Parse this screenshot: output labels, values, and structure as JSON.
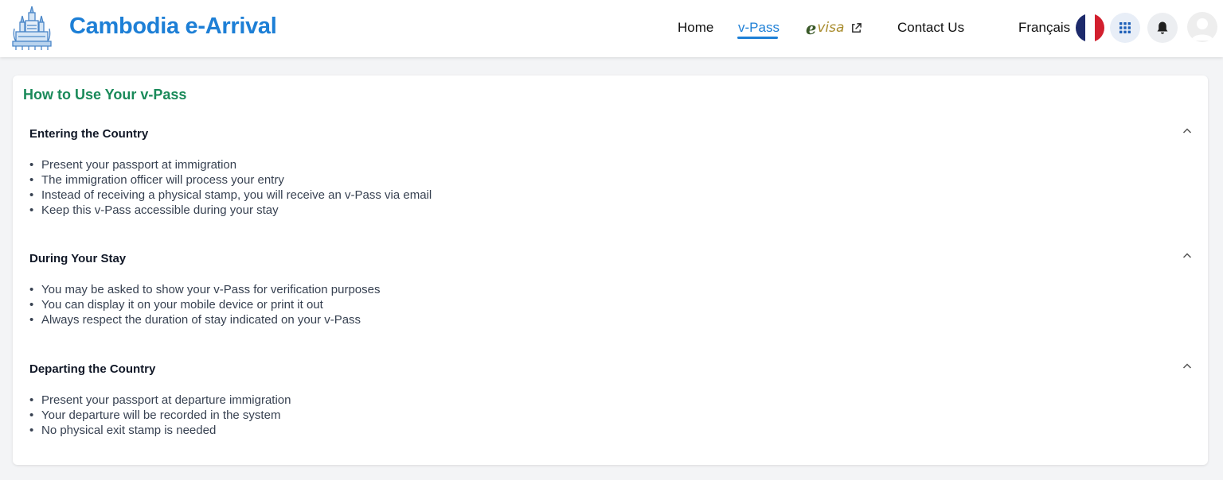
{
  "header": {
    "app_title": "Cambodia e-Arrival",
    "nav": {
      "home": "Home",
      "vpass": "v-Pass",
      "evisa_mark": "e",
      "evisa_text": "visa",
      "contact": "Contact Us",
      "language": "Français"
    },
    "active_color": "#1d7fd6"
  },
  "card": {
    "title": "How to Use Your v-Pass",
    "sections": [
      {
        "title": "Entering the Country",
        "items": [
          "Present your passport at immigration",
          "The immigration officer will process your entry",
          "Instead of receiving a physical stamp, you will receive an v-Pass via email",
          "Keep this v-Pass accessible during your stay"
        ]
      },
      {
        "title": "During Your Stay",
        "items": [
          "You may be asked to show your v-Pass for verification purposes",
          "You can display it on your mobile device or print it out",
          "Always respect the duration of stay indicated on your v-Pass"
        ]
      },
      {
        "title": "Departing the Country",
        "items": [
          "Present your passport at departure immigration",
          "Your departure will be recorded in the system",
          "No physical exit stamp is needed"
        ]
      }
    ]
  }
}
